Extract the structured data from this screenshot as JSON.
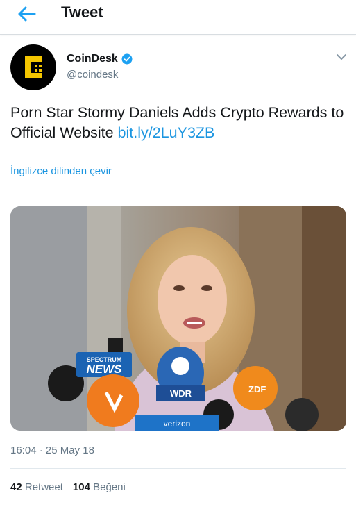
{
  "header": {
    "title": "Tweet",
    "back_icon": "arrow-left-icon",
    "accent": "#1da1f2"
  },
  "tweet": {
    "author": {
      "name": "CoinDesk",
      "handle": "@coindesk",
      "verified_icon": "verified-badge-icon",
      "avatar_icon": "coindesk-logo-icon"
    },
    "text": "Porn Star Stormy Daniels Adds Crypto Rewards to Official Website ",
    "link": "bit.ly/2LuY3ZB",
    "translate_label": "İngilizce dilinden çevir",
    "media": {
      "type": "photo",
      "caption_marks": [
        "SPECTRUM",
        "NEWS",
        "WDR",
        "ZDF",
        "verizon"
      ]
    },
    "timestamp": "16:04 · 25 May 18",
    "stats": {
      "retweets_count": "42",
      "retweets_label": "Retweet",
      "likes_count": "104",
      "likes_label": "Beğeni"
    }
  },
  "colors": {
    "link": "#1b95e0",
    "secondary_text": "#657786",
    "primary_text": "#14171a",
    "divider": "#e1e8ed"
  }
}
